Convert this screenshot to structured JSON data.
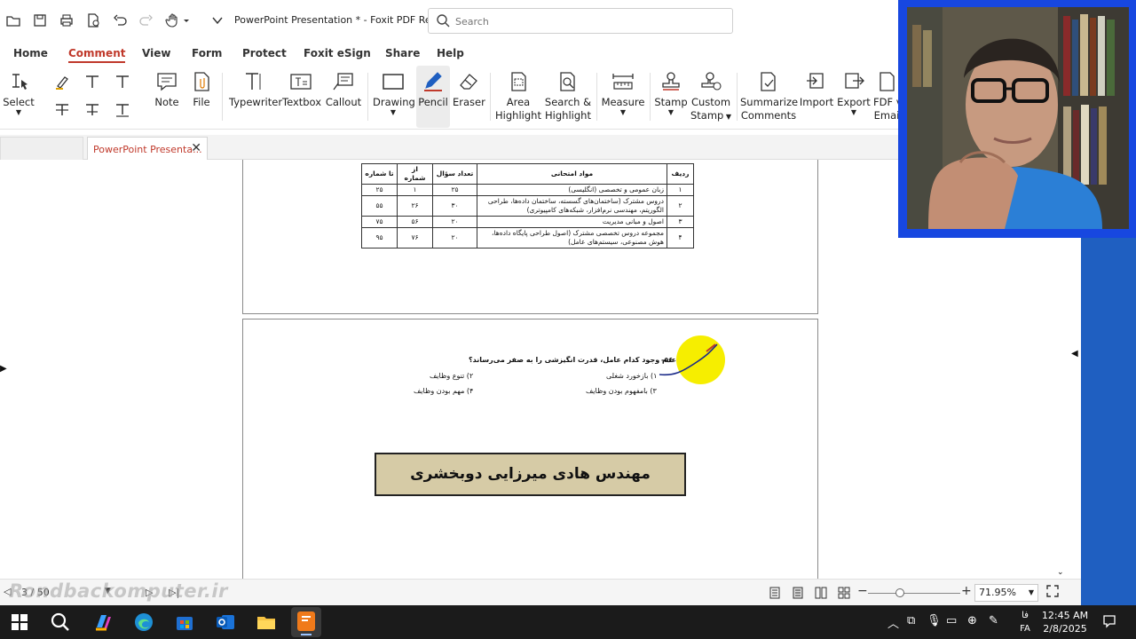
{
  "app": {
    "title": "PowerPoint Presentation * - Foxit PDF Read..."
  },
  "search": {
    "placeholder": "Search"
  },
  "menu": {
    "tabs": [
      "Home",
      "Comment",
      "View",
      "Form",
      "Protect",
      "Foxit eSign",
      "Share",
      "Help"
    ],
    "active": "Comment"
  },
  "ribbon": {
    "select": "Select",
    "note": "Note",
    "file": "File",
    "typewriter": "Typewriter",
    "textbox": "Textbox",
    "callout": "Callout",
    "drawing": "Drawing",
    "pencil": "Pencil",
    "eraser": "Eraser",
    "area_highlight_1": "Area",
    "area_highlight_2": "Highlight",
    "search_highlight_1": "Search &",
    "search_highlight_2": "Highlight",
    "measure": "Measure",
    "stamp": "Stamp",
    "custom_stamp_1": "Custom",
    "custom_stamp_2": "Stamp",
    "summarize_1": "Summarize",
    "summarize_2": "Comments",
    "import": "Import",
    "export": "Export",
    "fdf_1": "FDF v",
    "fdf_2": "Emai"
  },
  "doc_tab": {
    "title": "PowerPoint Presenta..."
  },
  "exam_table": {
    "headers": [
      "ردیف",
      "مواد امتحانی",
      "تعداد سؤال",
      "از شماره",
      "تا شماره"
    ],
    "rows": [
      [
        "۱",
        "زبان عمومی و تخصصی (انگلیسی)",
        "۲۵",
        "۱",
        "۲۵"
      ],
      [
        "۲",
        "دروس مشترک (ساختمان‌های گسسته، ساختمان داده‌ها، طراحی الگوریتم، مهندسی نرم‌افزار، شبکه‌های کامپیوتری)",
        "۳۰",
        "۲۶",
        "۵۵"
      ],
      [
        "۳",
        "اصول و مبانی مدیریت",
        "۲۰",
        "۵۶",
        "۷۵"
      ],
      [
        "۴",
        "مجموعه دروس تخصصی مشترک (اصول طراحی پایگاه داده‌ها، هوش مصنوعی، سیستم‌های عامل)",
        "۲۰",
        "۷۶",
        "۹۵"
      ]
    ]
  },
  "question": {
    "number": "۵۶-",
    "text": "عدم وجود کدام عامل، قدرت انگیزشی را به صفر می‌رساند؟",
    "options": [
      "۱) بازخورد شغلی",
      "۲) تنوع وظایف",
      "۳) بامفهوم بودن وظایف",
      "۴) مهم بودن وظایف"
    ]
  },
  "author_box": {
    "text": "مهندس هادی میرزایی دوبخشری"
  },
  "statusbar": {
    "page": "3 / 50",
    "zoom": "71.95%",
    "watermark": "Rondbackomputer.ir"
  },
  "taskbar": {
    "time": "12:45 AM",
    "date": "2/8/2025",
    "lang_top": "فا",
    "lang_bottom": "FA"
  },
  "colors": {
    "accent": "#c0392b",
    "webcam_border": "#1747e0",
    "right_panel": "#1f5fc1",
    "highlight": "#f6ee00",
    "name_box": "#d6cba6"
  }
}
